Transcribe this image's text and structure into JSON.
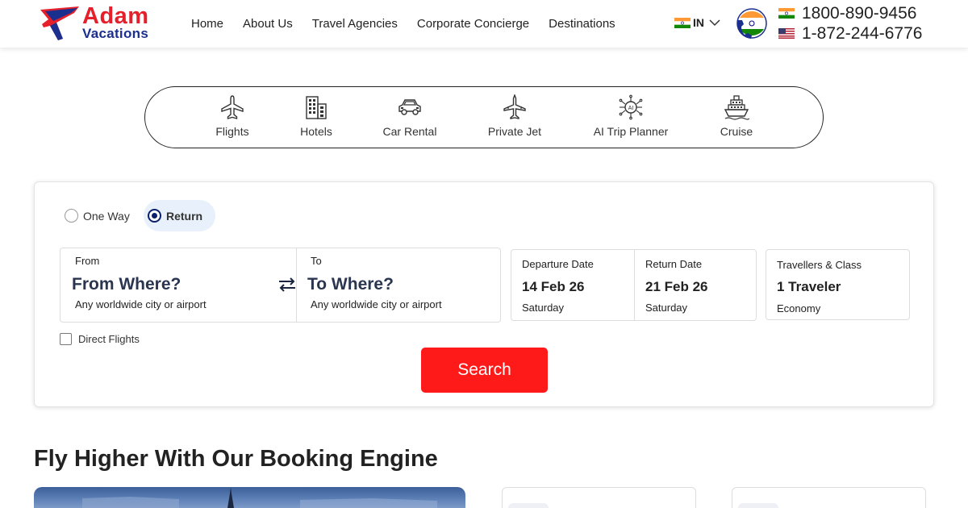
{
  "brand": {
    "logo_word1": "Adam",
    "logo_word2": "Vacations",
    "primary_color": "#e5202a",
    "secondary_color": "#1b2f8f"
  },
  "nav": {
    "items": [
      "Home",
      "About Us",
      "Travel Agencies",
      "Corporate Concierge",
      "Destinations"
    ]
  },
  "header": {
    "country_code": "IN",
    "phone_india": "1800-890-9456",
    "phone_us": "1-872-244-6776"
  },
  "services": [
    {
      "label": "Flights",
      "icon": "plane-icon"
    },
    {
      "label": "Hotels",
      "icon": "building-icon"
    },
    {
      "label": "Car Rental",
      "icon": "car-icon"
    },
    {
      "label": "Private Jet",
      "icon": "jet-icon"
    },
    {
      "label": "AI Trip Planner",
      "icon": "ai-chip-icon"
    },
    {
      "label": "Cruise",
      "icon": "ship-icon"
    }
  ],
  "search": {
    "trip_types": [
      "One Way",
      "Return"
    ],
    "selected_trip": "Return",
    "from_label": "From",
    "from_value": "From Where?",
    "from_hint": "Any worldwide city or airport",
    "to_label": "To",
    "to_value": "To Where?",
    "to_hint": "Any worldwide city or airport",
    "departure_label": "Departure Date",
    "departure_date": "14 Feb 26",
    "departure_day": "Saturday",
    "return_label": "Return Date",
    "return_date": "21 Feb 26",
    "return_day": "Saturday",
    "travellers_label": "Travellers & Class",
    "travellers_value": "1 Traveler",
    "class_value": "Economy",
    "direct_flights_label": "Direct Flights",
    "direct_flights_checked": false,
    "search_button": "Search",
    "search_button_color": "#ff1a1a"
  },
  "section": {
    "title": "Fly Higher With Our Booking Engine"
  }
}
